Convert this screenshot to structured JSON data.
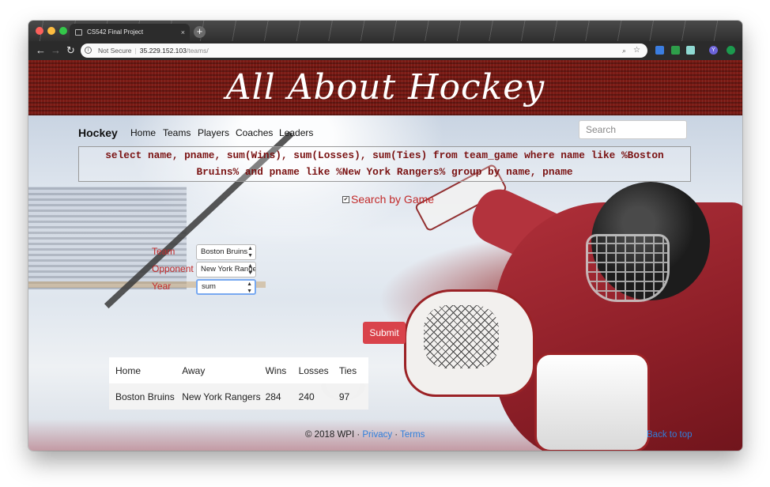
{
  "browser": {
    "tab_title": "CS542 Final Project",
    "tab_close": "×",
    "new_tab": "+",
    "security_label": "Not Secure",
    "url_host": "35.229.152.103",
    "url_path": "/teams/",
    "nav_back": "←",
    "nav_forward": "→",
    "nav_reload": "↻",
    "ext_y": "Y"
  },
  "banner": {
    "title": "All About Hockey"
  },
  "navbar": {
    "brand": "Hockey",
    "links": [
      "Home",
      "Teams",
      "Players",
      "Coaches",
      "Leaders"
    ],
    "search_placeholder": "Search"
  },
  "query": {
    "line1": "select name, pname, sum(Wins), sum(Losses), sum(Ties) from team_game where name like %Boston",
    "line2": "Bruins% and pname like %New York Rangers% group by name, pname"
  },
  "form": {
    "checkbox_checked": true,
    "checkbox_mark": "✔",
    "checkbox_label": "Search by Game",
    "team_label": "Team",
    "team_value": "Boston Bruins",
    "opponent_label": "Opponent",
    "opponent_value": "New York Rangers",
    "year_label": "Year",
    "year_value": "sum",
    "select_arrow": "▲▼",
    "submit_label": "Submit"
  },
  "results": {
    "headers": [
      "Home",
      "Away",
      "Wins",
      "Losses",
      "Ties"
    ],
    "rows": [
      [
        "Boston Bruins",
        "New York Rangers",
        "284",
        "240",
        "97"
      ]
    ]
  },
  "footer": {
    "copyright": "© 2018 WPI · ",
    "privacy": "Privacy",
    "dot": " · ",
    "terms": "Terms",
    "back_to_top": "Back to top"
  },
  "colors": {
    "banner": "#7a1a14",
    "accent_red": "#c22a2a",
    "submit": "#d9434b",
    "link": "#2f7fdc"
  }
}
